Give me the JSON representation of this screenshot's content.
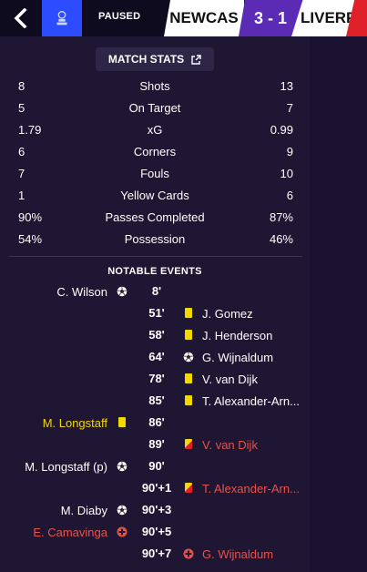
{
  "header": {
    "status": "PAUSED",
    "home_team": "NEWCAS",
    "score": "3 - 1",
    "away_team": "LIVERP"
  },
  "stats_header": "MATCH STATS",
  "stats": [
    {
      "home": "8",
      "label": "Shots",
      "away": "13"
    },
    {
      "home": "5",
      "label": "On Target",
      "away": "7"
    },
    {
      "home": "1.79",
      "label": "xG",
      "away": "0.99"
    },
    {
      "home": "6",
      "label": "Corners",
      "away": "9"
    },
    {
      "home": "7",
      "label": "Fouls",
      "away": "10"
    },
    {
      "home": "1",
      "label": "Yellow Cards",
      "away": "6"
    },
    {
      "home": "90%",
      "label": "Passes Completed",
      "away": "87%"
    },
    {
      "home": "54%",
      "label": "Possession",
      "away": "46%"
    }
  ],
  "events_title": "NOTABLE EVENTS",
  "events": [
    {
      "minute": "8'",
      "home_name": "C. Wilson",
      "home_icon": "goal-icon",
      "away_name": "",
      "away_icon": ""
    },
    {
      "minute": "51'",
      "home_name": "",
      "home_icon": "",
      "away_name": "J. Gomez",
      "away_icon": "yellow-card-icon"
    },
    {
      "minute": "58'",
      "home_name": "",
      "home_icon": "",
      "away_name": "J. Henderson",
      "away_icon": "yellow-card-icon"
    },
    {
      "minute": "64'",
      "home_name": "",
      "home_icon": "",
      "away_name": "G. Wijnaldum",
      "away_icon": "goal-icon"
    },
    {
      "minute": "78'",
      "home_name": "",
      "home_icon": "",
      "away_name": "V. van Dijk",
      "away_icon": "yellow-card-icon"
    },
    {
      "minute": "85'",
      "home_name": "",
      "home_icon": "",
      "away_name": "T. Alexander-Arn...",
      "away_icon": "yellow-card-icon"
    },
    {
      "minute": "86'",
      "home_name": "M. Longstaff",
      "home_icon": "yellow-card-icon",
      "away_name": "",
      "away_icon": ""
    },
    {
      "minute": "89'",
      "home_name": "",
      "home_icon": "",
      "away_name": "V. van Dijk",
      "away_icon": "second-yellow-icon"
    },
    {
      "minute": "90'",
      "home_name": "M. Longstaff (p)",
      "home_icon": "penalty-goal-icon",
      "away_name": "",
      "away_icon": ""
    },
    {
      "minute": "90'+1",
      "home_name": "",
      "home_icon": "",
      "away_name": "T. Alexander-Arn...",
      "away_icon": "second-yellow-icon"
    },
    {
      "minute": "90'+3",
      "home_name": "M. Diaby",
      "home_icon": "goal-icon",
      "away_name": "",
      "away_icon": ""
    },
    {
      "minute": "90'+5",
      "home_name": "E. Camavinga",
      "home_icon": "injury-icon",
      "away_name": "",
      "away_icon": ""
    },
    {
      "minute": "90'+7",
      "home_name": "",
      "home_icon": "",
      "away_name": "G. Wijnaldum",
      "away_icon": "injury-icon"
    }
  ],
  "colors": {
    "home_accent": "#2e4cff",
    "score_bg": "#5b2bb5",
    "away_accent": "#e0212a",
    "yellow": "#f1d800",
    "red": "#e8524c"
  }
}
